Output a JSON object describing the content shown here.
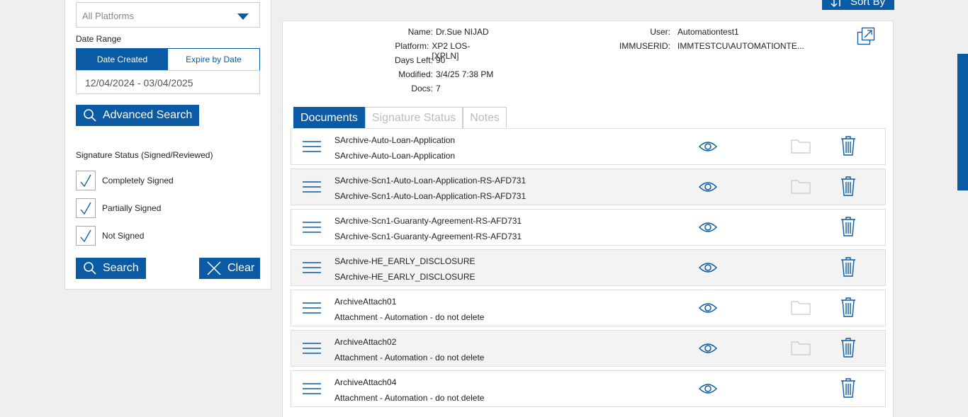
{
  "filters": {
    "platform": "All Platforms",
    "date_range_label": "Date Range",
    "date_tabs": [
      "Date Created",
      "Expire by Date"
    ],
    "date_value": "12/04/2024 - 03/04/2025",
    "advanced_search": "Advanced Search",
    "signature_status_label": "Signature Status (Signed/Reviewed)",
    "checks": [
      "Completely Signed",
      "Partially Signed",
      "Not Signed"
    ],
    "search": "Search",
    "clear": "Clear"
  },
  "toolbar": {
    "sort_by": "Sort By"
  },
  "record": {
    "left": [
      {
        "k": "Name:",
        "v": "Dr.Sue NIJAD"
      },
      {
        "k": "Platform:",
        "v": "XP2 LOS-[XPLN]"
      },
      {
        "k": "Days Left:",
        "v": "90"
      },
      {
        "k": "Modified:",
        "v": "3/4/25 7:38 PM"
      },
      {
        "k": "Docs:",
        "v": "7"
      }
    ],
    "right": [
      {
        "k": "User:",
        "v": "Automationtest1"
      },
      {
        "k": "IMMUSERID:",
        "v": "IMMTESTCU\\AUTOMATIONTE..."
      }
    ]
  },
  "tabs": [
    "Documents",
    "Signature Status",
    "Notes"
  ],
  "documents": [
    {
      "name": "SArchive-Auto-Loan-Application",
      "desc": "SArchive-Auto-Loan-Application"
    },
    {
      "name": "SArchive-Scn1-Auto-Loan-Application-RS-AFD731",
      "desc": "SArchive-Scn1-Auto-Loan-Application-RS-AFD731"
    },
    {
      "name": "SArchive-Scn1-Guaranty-Agreement-RS-AFD731",
      "desc": "SArchive-Scn1-Guaranty-Agreement-RS-AFD731"
    },
    {
      "name": "SArchive-HE_EARLY_DISCLOSURE",
      "desc": "SArchive-HE_EARLY_DISCLOSURE"
    },
    {
      "name": "ArchiveAttach01",
      "desc": "Attachment - Automation - do not delete"
    },
    {
      "name": "ArchiveAttach02",
      "desc": "Attachment - Automation - do not delete"
    },
    {
      "name": "ArchiveAttach04",
      "desc": "Attachment - Automation - do not delete"
    }
  ],
  "colors": {
    "accent": "#0a5aa5"
  }
}
